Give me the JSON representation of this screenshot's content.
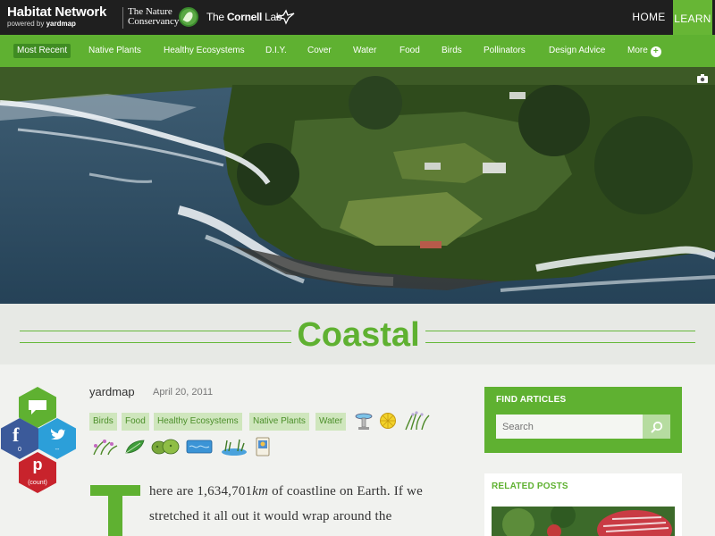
{
  "header": {
    "brand_title": "Habitat Network",
    "brand_sub_prefix": "powered by ",
    "brand_sub_name": "yardmap",
    "partner1_line1": "The Nature",
    "partner1_line2": "Conservancy",
    "partner2_light": "The ",
    "partner2_bold": "Cornell",
    "partner2_tail": " Lab",
    "nav": {
      "home": "HOME",
      "learn": "LEARN"
    }
  },
  "categories": [
    "Most Recent",
    "Native Plants",
    "Healthy Ecosystems",
    "D.I.Y.",
    "Cover",
    "Water",
    "Food",
    "Birds",
    "Pollinators",
    "Design Advice",
    "More"
  ],
  "page_title": "Coastal",
  "share": {
    "facebook_count": "0",
    "twitter_count": "--",
    "pinterest_count": "(count)"
  },
  "article": {
    "author": "yardmap",
    "date": "April 20, 2011",
    "tags": [
      "Birds",
      "Food",
      "Healthy Ecosystems",
      "Native Plants",
      "Water"
    ],
    "body_line1_prefix": "here are 1,634,701",
    "body_line1_unit": "km",
    "body_line1_suffix": " of coastline on Earth. If we",
    "body_line2": "stretched it all out it would wrap around the"
  },
  "sidebar": {
    "find_title": "FIND ARTICLES",
    "search_placeholder": "Search",
    "related_title": "RELATED POSTS"
  },
  "colors": {
    "accent": "#5fb131",
    "dark": "#1f1f1f",
    "tag_bg": "#cfe6bd"
  }
}
